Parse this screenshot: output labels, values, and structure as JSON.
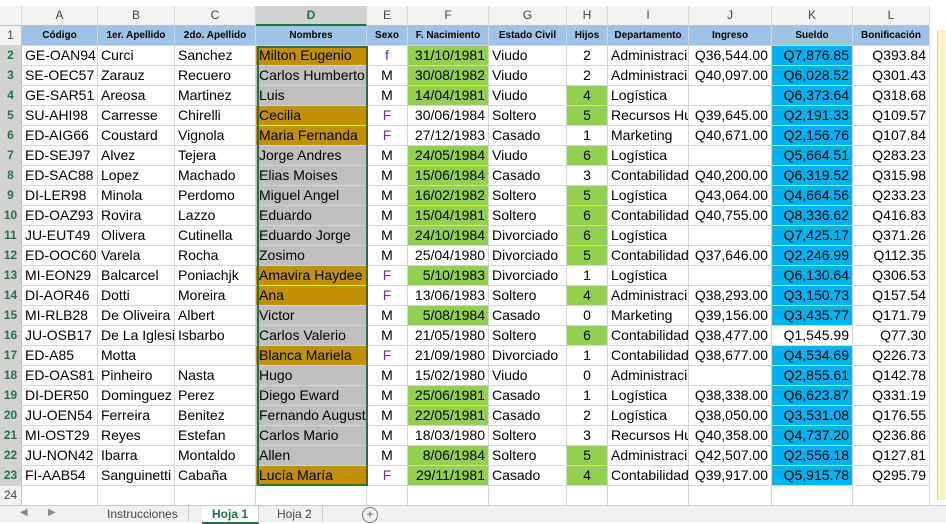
{
  "columns": [
    "A",
    "B",
    "C",
    "D",
    "E",
    "F",
    "G",
    "H",
    "I",
    "J",
    "K",
    "L"
  ],
  "header_row_number": "1",
  "headers": [
    "Código",
    "1er. Apellido",
    "2do. Apellido",
    "Nombres",
    "Sexo",
    "F. Nacimiento",
    "Estado Civil",
    "Hijos",
    "Departamento",
    "Ingreso",
    "Sueldo",
    "Bonificación"
  ],
  "rows": [
    {
      "n": "2",
      "codigo": "GE-OAN94",
      "ap1": "Curci",
      "ap2": "Sanchez",
      "nombres": "Milton Eugenio",
      "sexo": "f",
      "fnac": "31/10/1981",
      "estado": "Viudo",
      "hijos": "2",
      "depto": "Administraci",
      "ingreso": "Q36,544.00",
      "sueldo": "Q7,876.85",
      "bonif": "Q393.84"
    },
    {
      "n": "3",
      "codigo": "SE-OEC57",
      "ap1": "Zarauz",
      "ap2": "Recuero",
      "nombres": "Carlos Humberto",
      "sexo": "M",
      "fnac": "30/08/1982",
      "estado": "Viudo",
      "hijos": "2",
      "depto": "Administraci",
      "ingreso": "Q40,097.00",
      "sueldo": "Q6,028.52",
      "bonif": "Q301.43"
    },
    {
      "n": "4",
      "codigo": "GE-SAR51",
      "ap1": "Areosa",
      "ap2": "Martinez",
      "nombres": "Luis",
      "sexo": "M",
      "fnac": "14/04/1981",
      "estado": "Viudo",
      "hijos": "4",
      "depto": "Logística",
      "ingreso": "",
      "sueldo": "Q6,373.64",
      "bonif": "Q318.68"
    },
    {
      "n": "5",
      "codigo": "SU-AHI98",
      "ap1": "Carresse",
      "ap2": "Chirelli",
      "nombres": "Cecilia",
      "sexo": "F",
      "fnac": "30/06/1984",
      "estado": "Soltero",
      "hijos": "5",
      "depto": "Recursos Hur",
      "ingreso": "Q39,645.00",
      "sueldo": "Q2,191.33",
      "bonif": "Q109.57"
    },
    {
      "n": "6",
      "codigo": "ED-AIG66",
      "ap1": "Coustard",
      "ap2": "Vignola",
      "nombres": "Maria Fernanda",
      "sexo": "F",
      "fnac": "27/12/1983",
      "estado": "Casado",
      "hijos": "1",
      "depto": "Marketing",
      "ingreso": "Q40,671.00",
      "sueldo": "Q2,156.76",
      "bonif": "Q107.84"
    },
    {
      "n": "7",
      "codigo": "ED-SEJ97",
      "ap1": "Alvez",
      "ap2": "Tejera",
      "nombres": "Jorge Andres",
      "sexo": "M",
      "fnac": "24/05/1984",
      "estado": "Viudo",
      "hijos": "6",
      "depto": "Logística",
      "ingreso": "",
      "sueldo": "Q5,664.51",
      "bonif": "Q283.23"
    },
    {
      "n": "8",
      "codigo": "ED-SAC88",
      "ap1": "Lopez",
      "ap2": "Machado",
      "nombres": "Elias Moises",
      "sexo": "M",
      "fnac": "15/06/1984",
      "estado": "Casado",
      "hijos": "3",
      "depto": "Contabilidad",
      "ingreso": "Q40,200.00",
      "sueldo": "Q6,319.52",
      "bonif": "Q315.98"
    },
    {
      "n": "9",
      "codigo": "DI-LER98",
      "ap1": "Minola",
      "ap2": "Perdomo",
      "nombres": "Miguel Angel",
      "sexo": "M",
      "fnac": "16/02/1982",
      "estado": "Soltero",
      "hijos": "5",
      "depto": "Logística",
      "ingreso": "Q43,064.00",
      "sueldo": "Q4,664.56",
      "bonif": "Q233.23"
    },
    {
      "n": "10",
      "codigo": "ED-OAZ93",
      "ap1": "Rovira",
      "ap2": "Lazzo",
      "nombres": "Eduardo",
      "sexo": "M",
      "fnac": "15/04/1981",
      "estado": "Soltero",
      "hijos": "6",
      "depto": "Contabilidad",
      "ingreso": "Q40,755.00",
      "sueldo": "Q8,336.62",
      "bonif": "Q416.83"
    },
    {
      "n": "11",
      "codigo": "JU-EUT49",
      "ap1": "Olivera",
      "ap2": "Cutinella",
      "nombres": "Eduardo Jorge",
      "sexo": "M",
      "fnac": "24/10/1984",
      "estado": "Divorciado",
      "hijos": "6",
      "depto": "Logística",
      "ingreso": "",
      "sueldo": "Q7,425.17",
      "bonif": "Q371.26"
    },
    {
      "n": "12",
      "codigo": "ED-OOC60",
      "ap1": "Varela",
      "ap2": "Rocha",
      "nombres": "Zosimo",
      "sexo": "M",
      "fnac": "25/04/1980",
      "estado": "Divorciado",
      "hijos": "5",
      "depto": "Contabilidad",
      "ingreso": "Q37,646.00",
      "sueldo": "Q2,246.99",
      "bonif": "Q112.35"
    },
    {
      "n": "13",
      "codigo": "MI-EON29",
      "ap1": "Balcarcel",
      "ap2": "Poniachjk",
      "nombres": "Amavira Haydee",
      "sexo": "F",
      "fnac": "5/10/1983",
      "estado": "Divorciado",
      "hijos": "1",
      "depto": "Logística",
      "ingreso": "",
      "sueldo": "Q6,130.64",
      "bonif": "Q306.53"
    },
    {
      "n": "14",
      "codigo": "DI-AOR46",
      "ap1": "Dotti",
      "ap2": "Moreira",
      "nombres": "Ana",
      "sexo": "F",
      "fnac": "13/06/1983",
      "estado": "Soltero",
      "hijos": "4",
      "depto": "Administraci",
      "ingreso": "Q38,293.00",
      "sueldo": "Q3,150.73",
      "bonif": "Q157.54"
    },
    {
      "n": "15",
      "codigo": "MI-RLB28",
      "ap1": "De Oliveira",
      "ap2": "Albert",
      "nombres": "Victor",
      "sexo": "M",
      "fnac": "5/08/1984",
      "estado": "Casado",
      "hijos": "0",
      "depto": "Marketing",
      "ingreso": "Q39,156.00",
      "sueldo": "Q3,435.77",
      "bonif": "Q171.79"
    },
    {
      "n": "16",
      "codigo": "JU-OSB17",
      "ap1": "De La Iglesia",
      "ap2": "Isbarbo",
      "nombres": "Carlos Valerio",
      "sexo": "M",
      "fnac": "21/05/1980",
      "estado": "Soltero",
      "hijos": "6",
      "depto": "Contabilidad",
      "ingreso": "Q38,477.00",
      "sueldo": "Q1,545.99",
      "bonif": "Q77.30"
    },
    {
      "n": "17",
      "codigo": "ED-A85",
      "ap1": "Motta",
      "ap2": "",
      "nombres": "Blanca Mariela",
      "sexo": "F",
      "fnac": "21/09/1980",
      "estado": "Divorciado",
      "hijos": "1",
      "depto": "Contabilidad",
      "ingreso": "Q38,677.00",
      "sueldo": "Q4,534.69",
      "bonif": "Q226.73"
    },
    {
      "n": "18",
      "codigo": "ED-OAS81",
      "ap1": "Pinheiro",
      "ap2": "Nasta",
      "nombres": "Hugo",
      "sexo": "M",
      "fnac": "15/02/1980",
      "estado": "Viudo",
      "hijos": "0",
      "depto": "Administración",
      "ingreso": "",
      "sueldo": "Q2,855.61",
      "bonif": "Q142.78"
    },
    {
      "n": "19",
      "codigo": "DI-DER50",
      "ap1": "Dominguez",
      "ap2": "Perez",
      "nombres": "Diego Eward",
      "sexo": "M",
      "fnac": "25/06/1981",
      "estado": "Casado",
      "hijos": "1",
      "depto": "Logística",
      "ingreso": "Q38,338.00",
      "sueldo": "Q6,623.87",
      "bonif": "Q331.19"
    },
    {
      "n": "20",
      "codigo": "JU-OEN54",
      "ap1": "Ferreira",
      "ap2": "Benitez",
      "nombres": "Fernando August",
      "sexo": "M",
      "fnac": "22/05/1981",
      "estado": "Casado",
      "hijos": "2",
      "depto": "Logística",
      "ingreso": "Q38,050.00",
      "sueldo": "Q3,531.08",
      "bonif": "Q176.55"
    },
    {
      "n": "21",
      "codigo": "MI-OST29",
      "ap1": "Reyes",
      "ap2": "Estefan",
      "nombres": "Carlos Mario",
      "sexo": "M",
      "fnac": "18/03/1980",
      "estado": "Soltero",
      "hijos": "3",
      "depto": "Recursos Hur",
      "ingreso": "Q40,358.00",
      "sueldo": "Q4,737.20",
      "bonif": "Q236.86"
    },
    {
      "n": "22",
      "codigo": "JU-NON42",
      "ap1": "Ibarra",
      "ap2": "Montaldo",
      "nombres": "Allen",
      "sexo": "M",
      "fnac": "8/06/1984",
      "estado": "Soltero",
      "hijos": "5",
      "depto": "Administraci",
      "ingreso": "Q42,507.00",
      "sueldo": "Q2,556.18",
      "bonif": "Q127.81"
    },
    {
      "n": "23",
      "codigo": "FI-AAB54",
      "ap1": "Sanguinetti",
      "ap2": "Cabaña",
      "nombres": "Lucía María",
      "sexo": "F",
      "fnac": "29/11/1981",
      "estado": "Casado",
      "hijos": "4",
      "depto": "Contabilidad",
      "ingreso": "Q39,917.00",
      "sueldo": "Q5,915.78",
      "bonif": "Q295.79"
    }
  ],
  "empty_row_number": "24",
  "tabs": {
    "sheets": [
      "Instrucciones",
      "Hoja 1",
      "Hoja 2"
    ],
    "active": "Hoja 1",
    "add": "+"
  },
  "colors": {
    "green": "#92d050",
    "blue": "#00b0f0",
    "gold": "#c09000",
    "gray": "#bfbfbf",
    "header": "#9dc3e6",
    "accent": "#217346"
  }
}
